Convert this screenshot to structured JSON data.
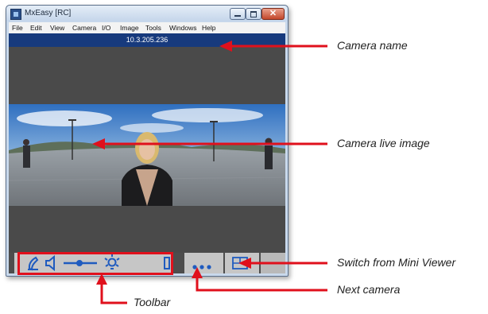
{
  "window": {
    "title": "MxEasy [RC]",
    "menu": [
      "File",
      "Edit",
      "View",
      "Camera",
      "I/O",
      "Image",
      "Tools",
      "Windows",
      "Help"
    ]
  },
  "camera": {
    "name": "10.3.205.236"
  },
  "callouts": {
    "camera_name": "Camera name",
    "live_image": "Camera live image",
    "switch_mini_viewer": "Switch from Mini Viewer",
    "next_camera": "Next camera",
    "toolbar": "Toolbar"
  },
  "colors": {
    "name_bar": "#173a7d",
    "callout_arrow": "#e0101c",
    "toolbar_icon": "#1f5bbf",
    "client_bg": "#4a4a4a"
  },
  "toolbar_icons": [
    "microphone-icon",
    "speaker-icon",
    "volume-slider",
    "brightness-icon",
    "record-icon",
    "next-camera-icon",
    "switch-view-icon"
  ]
}
